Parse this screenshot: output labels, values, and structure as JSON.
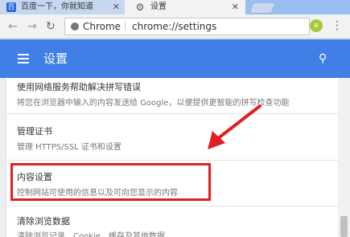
{
  "tabs": [
    {
      "label": "百度一下，你就知道",
      "icon": "baidu-icon",
      "close": "✕"
    },
    {
      "label": "设置",
      "icon": "gear-icon",
      "close": "✕"
    }
  ],
  "omnibox": {
    "chip": "Chrome",
    "url": "chrome://settings"
  },
  "header": {
    "title": "设置"
  },
  "settings": [
    {
      "title": "使用网络服务帮助解决拼写错误",
      "desc": "将您在浏览器中输入的内容发送给 Google，以便提供更智能的拼写检查功能"
    },
    {
      "title": "管理证书",
      "desc": "管理 HTTPS/SSL 证书和设置"
    },
    {
      "title": "内容设置",
      "desc": "控制网站可使用的信息以及可向您显示的内容"
    },
    {
      "title": "清除浏览数据",
      "desc": "清除浏览记录、Cookie、缓存及其他数据"
    }
  ],
  "colors": {
    "header": "#3f7fe6",
    "highlight": "#e02020",
    "arrow": "#e02020"
  }
}
